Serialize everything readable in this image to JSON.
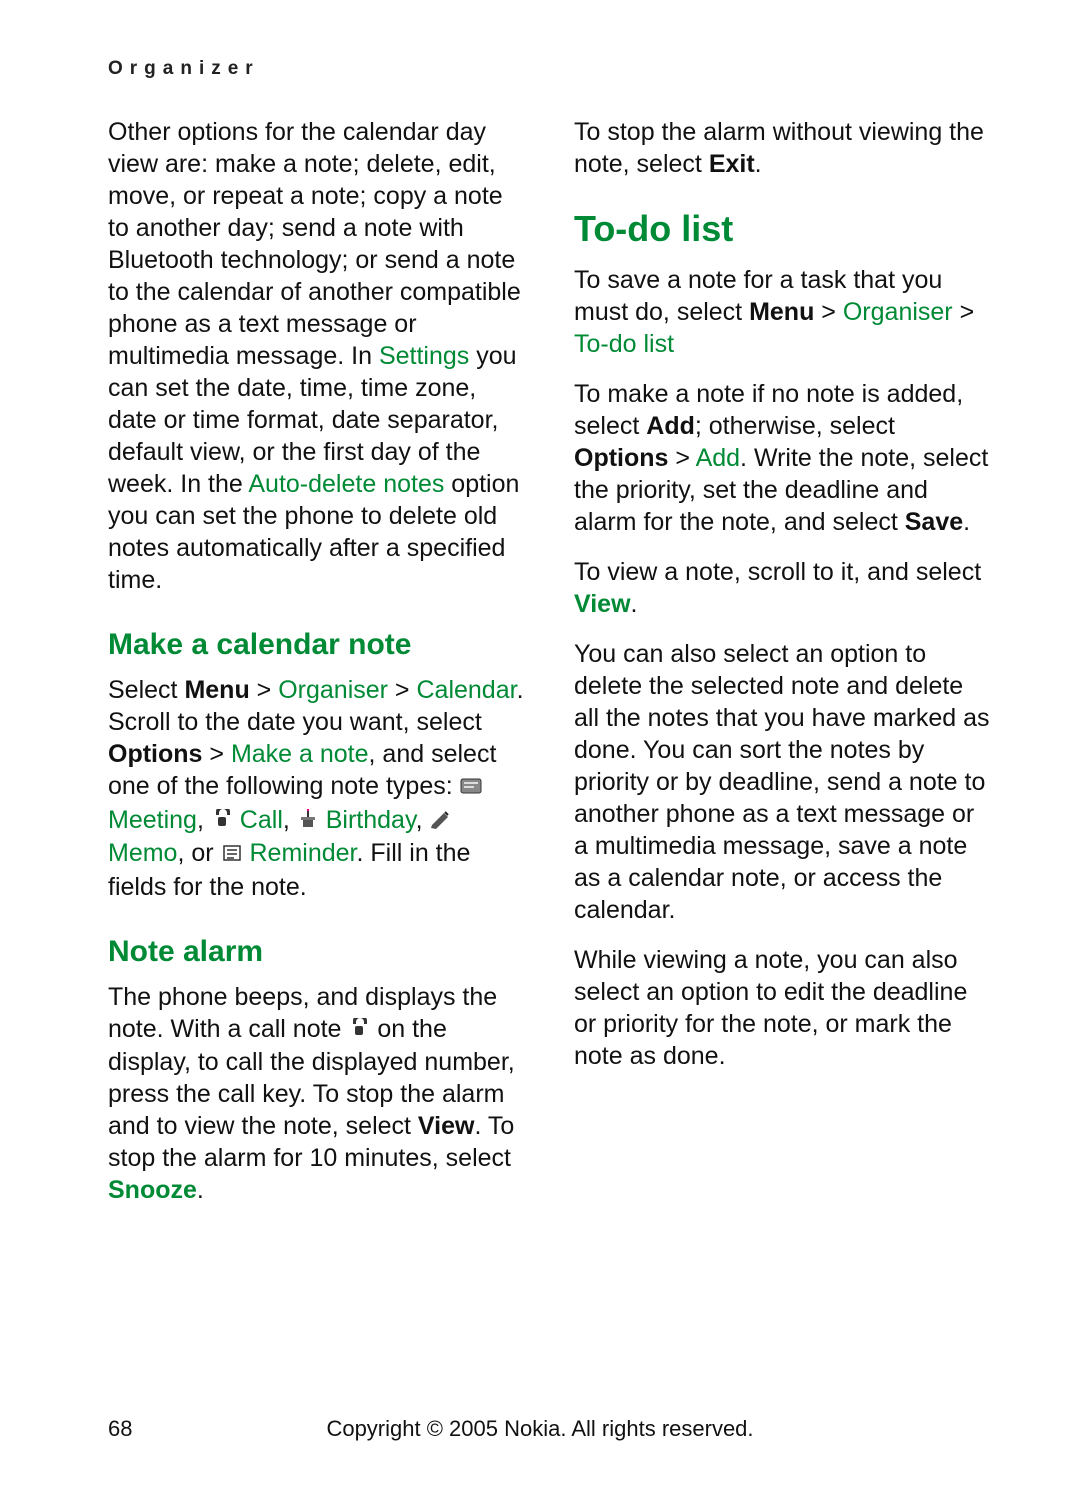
{
  "header": "Organizer",
  "page_number": "68",
  "footer": "Copyright © 2005 Nokia. All rights reserved.",
  "heading_makenote": "Make a calendar note",
  "heading_notealarm": "Note alarm",
  "heading_todo": "To-do list",
  "p1": {
    "t1": "Other options for the calendar day view are: make a note; delete, edit, move, or repeat a note; copy a note to another day; send a note with Bluetooth technology; or send a note to the calendar of another compatible phone as a text message or multimedia message. In ",
    "settings": "Settings",
    "t2": " you can set the date, time, time zone, date or time format, date separator, default view, or the first day of the week. In the ",
    "autodel": "Auto-delete notes",
    "t3": " option you can set the phone to delete old notes automatically after a specified time."
  },
  "p2": {
    "t1": "Select ",
    "menu": "Menu",
    "gt1": " > ",
    "organiser": "Organiser",
    "gt2": " > ",
    "calendar": "Calendar",
    "t2": ". Scroll to the date you want, select ",
    "options": "Options",
    "gt3": " > ",
    "makeanote": "Make a note",
    "t3": ", and select one of the following note types: ",
    "meeting": " Meeting",
    "comma1": ", ",
    "call": " Call",
    "comma2": ", ",
    "birthday": " Birthday",
    "comma3": ", ",
    "memo": " Memo",
    "or": ", or ",
    "reminder": " Reminder",
    "t4": ". Fill in the fields for the note."
  },
  "p3": {
    "t1": "The phone beeps, and displays the note. With a call note ",
    "t2": " on the display, to call the displayed number, press the call key. To stop the alarm and to view the note, select ",
    "view": "View",
    "t3": ". To stop the alarm for 10 minutes, select ",
    "snooze": "Snooze",
    "dot": "."
  },
  "p4": {
    "t1": "To stop the alarm without viewing the note, select ",
    "exit": "Exit",
    "dot": "."
  },
  "p5": {
    "t1": "To save a note for a task that you must do, select ",
    "menu": "Menu",
    "gt1": " > ",
    "organiser": "Organiser",
    "gt2": " > ",
    "todolist": "To-do list"
  },
  "p6": {
    "t1": "To make a note if no note is added, select ",
    "add1": "Add",
    "t2": "; otherwise, select ",
    "options": "Options",
    "gt": " > ",
    "add2": "Add",
    "t3": ". Write the note, select the priority, set the deadline and alarm for the note, and select ",
    "save": "Save",
    "dot": "."
  },
  "p7": {
    "t1": "To view a note, scroll to it, and select ",
    "view": "View",
    "dot": "."
  },
  "p8": "You can also select an option to delete the selected note and delete all the notes that you have marked as done. You can sort the notes by priority or by deadline, send a note to another phone as a text message or a multimedia message, save a note as a calendar note, or access the calendar.",
  "p9": "While viewing a note, you can also select an option to edit the deadline or priority for the note, or mark the note as done."
}
